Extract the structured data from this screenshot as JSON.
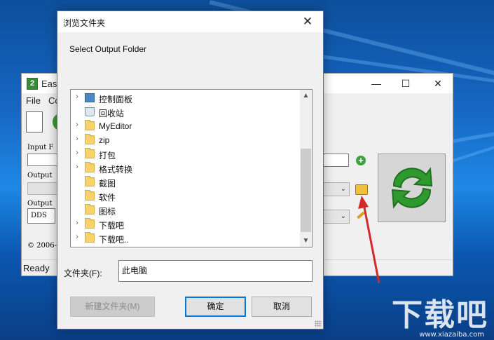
{
  "desktop": {
    "watermark": "下载吧",
    "watermark_sub": "www.xiazaiba.com"
  },
  "app_window": {
    "title": "Easy",
    "menu": [
      "File",
      "Co"
    ],
    "labels": {
      "input": "Input F",
      "output1": "Output",
      "output2": "Output"
    },
    "format_value": "DDS",
    "copyright": "© 2006-",
    "status": "Ready",
    "window_controls": {
      "minimize": "—",
      "maximize": "☐",
      "close": "✕"
    }
  },
  "dialog": {
    "title": "浏览文件夹",
    "description": "Select Output Folder",
    "tree": [
      {
        "label": "控制面板",
        "icon": "control-panel-icon",
        "expandable": true
      },
      {
        "label": "回收站",
        "icon": "recycle-bin-icon",
        "expandable": false
      },
      {
        "label": "MyEditor",
        "icon": "folder-icon",
        "expandable": true
      },
      {
        "label": "zip",
        "icon": "folder-icon",
        "expandable": true
      },
      {
        "label": "打包",
        "icon": "folder-icon",
        "expandable": true
      },
      {
        "label": "格式转换",
        "icon": "folder-icon",
        "expandable": true
      },
      {
        "label": "截图",
        "icon": "folder-icon",
        "expandable": false
      },
      {
        "label": "软件",
        "icon": "folder-icon",
        "expandable": false
      },
      {
        "label": "图标",
        "icon": "folder-icon",
        "expandable": false
      },
      {
        "label": "下载吧",
        "icon": "folder-icon",
        "expandable": true
      },
      {
        "label": "下载吧..",
        "icon": "folder-icon",
        "expandable": true
      }
    ],
    "folder_label": "文件夹(F):",
    "folder_value": "此电脑",
    "buttons": {
      "new_folder": "新建文件夹(M)",
      "ok": "确定",
      "cancel": "取消"
    },
    "close_glyph": "✕"
  },
  "colors": {
    "accent": "#0078d7",
    "arrow": "#d12a2a",
    "convert_green": "#3aa23a"
  }
}
